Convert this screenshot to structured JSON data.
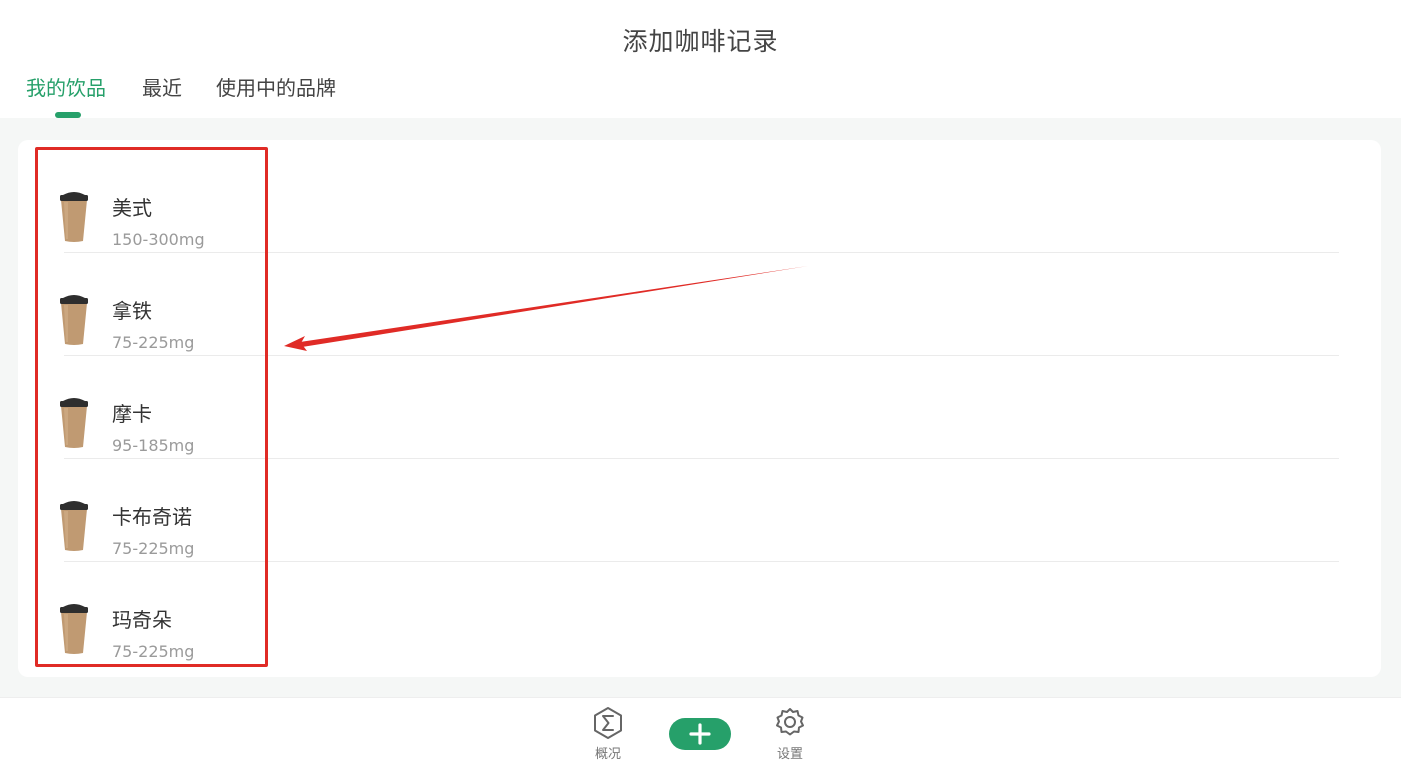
{
  "header": {
    "title": "添加咖啡记录",
    "tabs": [
      {
        "label": "我的饮品",
        "active": true
      },
      {
        "label": "最近",
        "active": false
      },
      {
        "label": "使用中的品牌",
        "active": false
      }
    ]
  },
  "drinks": [
    {
      "name": "美式",
      "caffeine": "150-300mg",
      "icon": "coffee-cup-icon"
    },
    {
      "name": "拿铁",
      "caffeine": "75-225mg",
      "icon": "coffee-cup-icon"
    },
    {
      "name": "摩卡",
      "caffeine": "95-185mg",
      "icon": "coffee-cup-icon"
    },
    {
      "name": "卡布奇诺",
      "caffeine": "75-225mg",
      "icon": "coffee-cup-icon"
    },
    {
      "name": "玛奇朵",
      "caffeine": "75-225mg",
      "icon": "coffee-cup-icon"
    }
  ],
  "bottom_nav": {
    "overview": {
      "label": "概况",
      "icon": "sigma-hexagon-icon"
    },
    "add": {
      "icon": "plus-icon"
    },
    "settings": {
      "label": "设置",
      "icon": "gear-icon"
    }
  },
  "colors": {
    "accent": "#26a06a",
    "annotation": "#e02b26",
    "cup_body": "#c09a72",
    "cup_lid": "#2e2e2e"
  }
}
